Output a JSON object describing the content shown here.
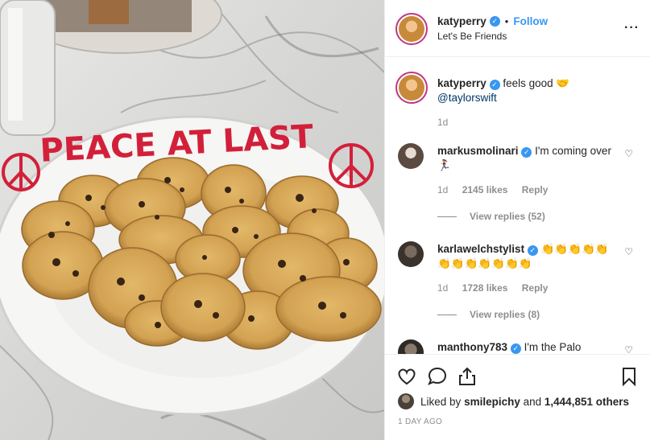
{
  "header": {
    "username": "katyperry",
    "separator": "•",
    "follow_label": "Follow",
    "location": "Let's Be Friends",
    "more_label": "···"
  },
  "photo": {
    "plate_text": "PEACE AT LAST",
    "colors": {
      "icing": "#d3203a",
      "cookie": "#d9aa5a",
      "plate": "#f6f6f4",
      "marble": "#d7d7d5"
    }
  },
  "caption": {
    "username": "katyperry",
    "text": "feels good 🤝",
    "mention": "@taylorswift",
    "time": "1d"
  },
  "comments": [
    {
      "username": "markusmolinari",
      "text": "I'm coming over 🏃‍♀️",
      "time": "1d",
      "likes": "2145 likes",
      "reply": "Reply",
      "view_replies": "View replies (52)"
    },
    {
      "username": "karlawelchstylist",
      "text": "👏👏👏👏👏👏👏👏👏👏👏👏",
      "time": "1d",
      "likes": "1728 likes",
      "reply": "Reply",
      "view_replies": "View replies (8)"
    },
    {
      "username": "manthony783",
      "text": "I'm the Palo",
      "time": "",
      "likes": "",
      "reply": "",
      "view_replies": ""
    }
  ],
  "actions": {
    "likes_prefix": "Liked by",
    "likes_user": "smilepichy",
    "likes_and": "and",
    "likes_count": "1,444,851 others",
    "timestamp": "1 DAY AGO"
  },
  "colors": {
    "accent": "#3897f0",
    "verified": "#3897f0",
    "muted": "#8e8e8e",
    "text": "#262626"
  }
}
